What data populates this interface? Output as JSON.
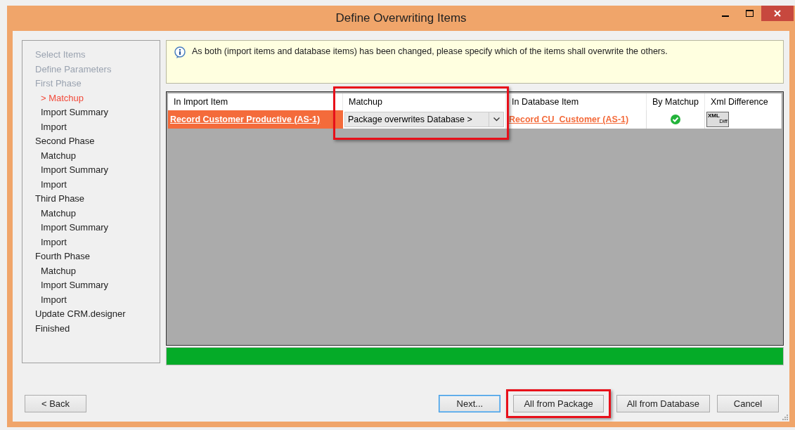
{
  "window": {
    "title": "Define Overwriting Items"
  },
  "steps": [
    {
      "label": "Select Items",
      "disabled": true,
      "selected": false
    },
    {
      "label": "Define Parameters",
      "disabled": true,
      "selected": false
    },
    {
      "label": "First Phase",
      "disabled": true,
      "selected": false,
      "children": [
        {
          "label": "> Matchup",
          "disabled": false,
          "selected": true
        },
        {
          "label": "Import Summary",
          "disabled": false,
          "selected": false
        },
        {
          "label": "Import",
          "disabled": false,
          "selected": false
        }
      ]
    },
    {
      "label": "Second Phase",
      "disabled": false,
      "selected": false,
      "children": [
        {
          "label": "Matchup",
          "disabled": false,
          "selected": false
        },
        {
          "label": "Import Summary",
          "disabled": false,
          "selected": false
        },
        {
          "label": "Import",
          "disabled": false,
          "selected": false
        }
      ]
    },
    {
      "label": "Third Phase",
      "disabled": false,
      "selected": false,
      "children": [
        {
          "label": "Matchup",
          "disabled": false,
          "selected": false
        },
        {
          "label": "Import Summary",
          "disabled": false,
          "selected": false
        },
        {
          "label": "Import",
          "disabled": false,
          "selected": false
        }
      ]
    },
    {
      "label": "Fourth Phase",
      "disabled": false,
      "selected": false,
      "children": [
        {
          "label": "Matchup",
          "disabled": false,
          "selected": false
        },
        {
          "label": "Import Summary",
          "disabled": false,
          "selected": false
        },
        {
          "label": "Import",
          "disabled": false,
          "selected": false
        }
      ]
    },
    {
      "label": "Update CRM.designer",
      "disabled": false,
      "selected": false
    },
    {
      "label": "Finished",
      "disabled": false,
      "selected": false
    }
  ],
  "info": {
    "text": "As both (import items and database items) has been changed, please specify which of the items shall overwrite the others."
  },
  "table": {
    "columns": [
      {
        "label": "In Import Item",
        "highlighted": false
      },
      {
        "label": "Matchup",
        "highlighted": true
      },
      {
        "label": "In Database Item",
        "highlighted": false
      },
      {
        "label": "By Matchup",
        "highlighted": false
      },
      {
        "label": "Xml Difference",
        "highlighted": false
      }
    ],
    "rows": [
      {
        "import_item": "Record Customer Productive (AS-1)",
        "matchup": "Package overwrites Database >",
        "database_item": "Record CU_Customer (AS-1)",
        "by_matchup": true,
        "xml_diff": {
          "line1": "XML",
          "line2": "Diff"
        }
      }
    ]
  },
  "progress": {
    "level": 1
  },
  "buttons": [
    {
      "label": "< Back",
      "kind": "back",
      "highlighted": false,
      "focused": false
    },
    {
      "label": "Next...",
      "kind": "action",
      "highlighted": false,
      "focused": true
    },
    {
      "label": "All from Package",
      "kind": "action",
      "highlighted": true,
      "focused": false
    },
    {
      "label": "All from Database",
      "kind": "action",
      "highlighted": false,
      "focused": false
    },
    {
      "label": "Cancel",
      "kind": "action",
      "highlighted": false,
      "focused": false
    }
  ]
}
